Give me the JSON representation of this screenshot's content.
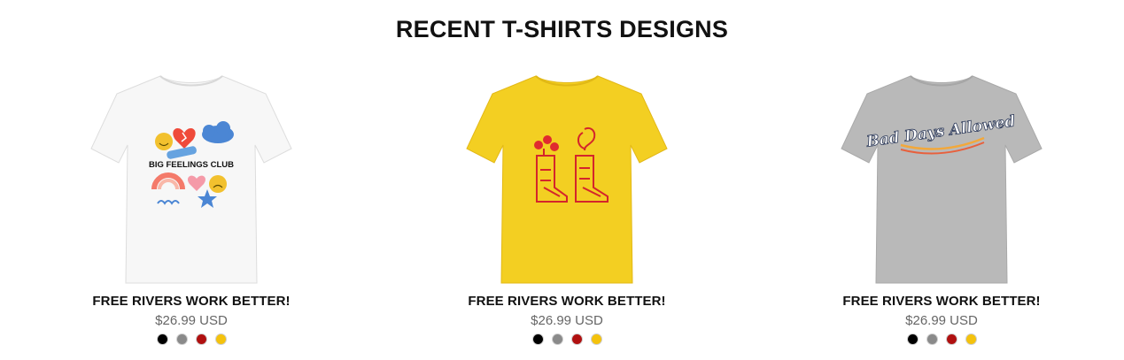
{
  "section": {
    "title": "RECENT T-SHIRTS DESIGNS"
  },
  "products": [
    {
      "name": "FREE RIVERS WORK BETTER!",
      "price": "$26.99 USD",
      "shirt_color": "#f7f7f7",
      "graphic_text": "BIG FEELINGS CLUB",
      "swatches": [
        "#000000",
        "#8a8a8a",
        "#b01010",
        "#f4c20d"
      ]
    },
    {
      "name": "FREE RIVERS WORK BETTER!",
      "price": "$26.99 USD",
      "shirt_color": "#f3cf22",
      "graphic_text": "",
      "swatches": [
        "#000000",
        "#8a8a8a",
        "#b01010",
        "#f4c20d"
      ]
    },
    {
      "name": "FREE RIVERS WORK BETTER!",
      "price": "$26.99 USD",
      "shirt_color": "#b9b9b9",
      "graphic_text": "Bad Days Allowed",
      "swatches": [
        "#000000",
        "#8a8a8a",
        "#b01010",
        "#f4c20d"
      ]
    }
  ]
}
